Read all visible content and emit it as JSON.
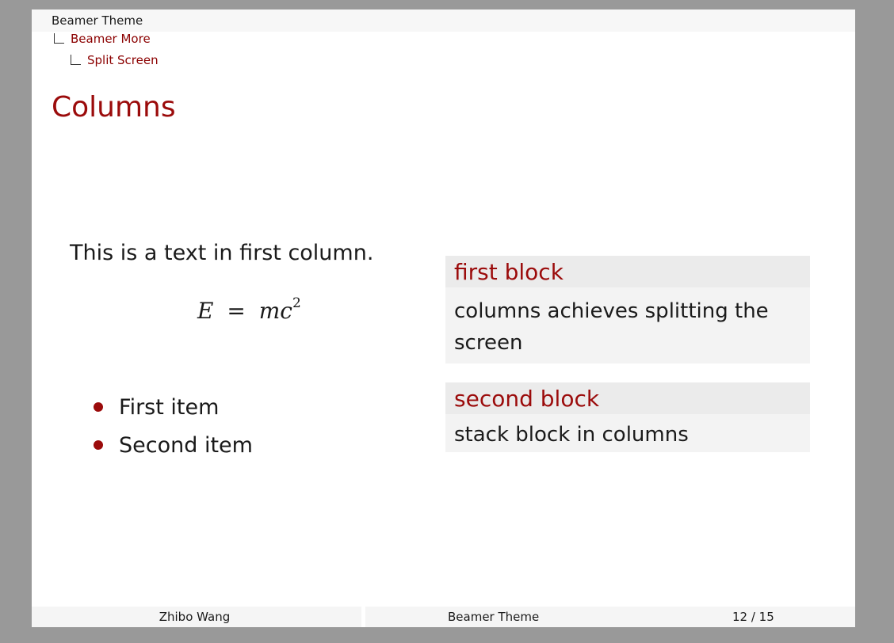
{
  "headline": {
    "section": "Beamer Theme",
    "subsection": "Beamer More",
    "subsubsection": "Split Screen"
  },
  "frame": {
    "title": "Columns"
  },
  "left_column": {
    "text": "This is a text in first column.",
    "equation": {
      "lhs": "E",
      "equals": "=",
      "rhs": "mc",
      "exponent": "2"
    },
    "items": [
      "First item",
      "Second item"
    ]
  },
  "right_column": {
    "blocks": [
      {
        "title": "first block",
        "body": "columns achieves splitting the screen"
      },
      {
        "title": "second block",
        "body": "stack block in columns"
      }
    ]
  },
  "footer": {
    "author": "Zhibo Wang",
    "title": "Beamer Theme",
    "page": "12 / 15"
  },
  "colors": {
    "accent": "#9b0b0b",
    "background": "#999999"
  }
}
